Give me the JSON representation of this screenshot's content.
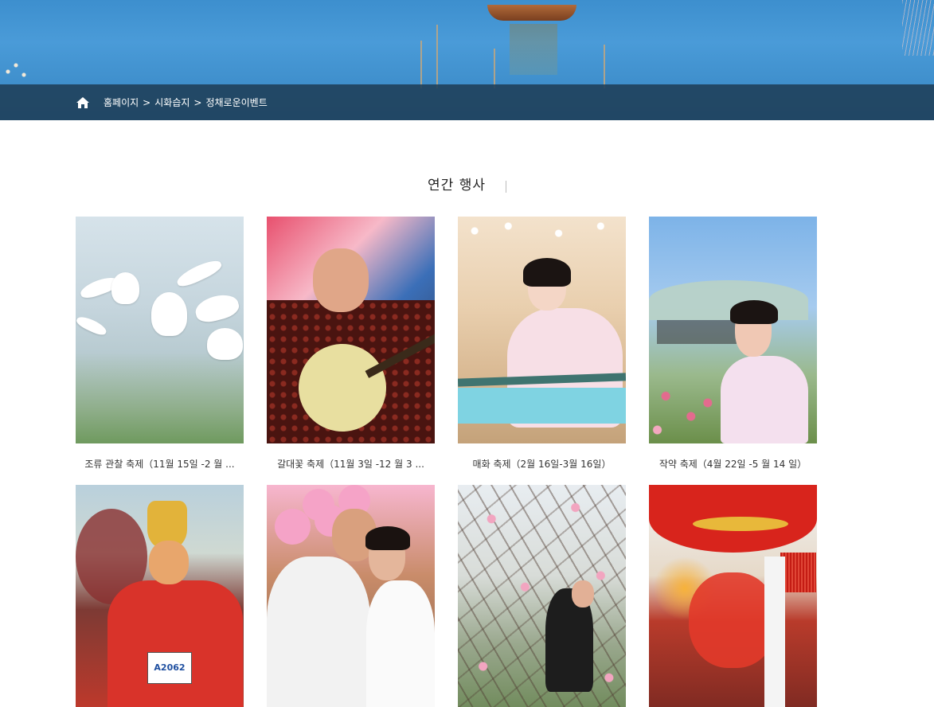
{
  "breadcrumb": {
    "home_icon": "home-icon",
    "items": [
      "홈페이지",
      "시화습지",
      "정채로운이벤트"
    ],
    "separator": ">"
  },
  "section": {
    "title": "연간 행사"
  },
  "events": [
    {
      "caption": "조류 관찰 축제（11월 15일 -2 월 ..."
    },
    {
      "caption": "갈대꽃 축제（11월 3일 -12 월 3 ..."
    },
    {
      "caption": "매화 축제（2월 16일-3월 16일）"
    },
    {
      "caption": "작약 축제（4월 22일 -5 월 14 일）"
    },
    {
      "caption": ""
    },
    {
      "caption": ""
    },
    {
      "caption": ""
    },
    {
      "caption": ""
    }
  ],
  "photo_texts": {
    "monkey_bib": "A2062"
  },
  "colors": {
    "breadcrumb_bar": "#1f3f58",
    "hero_sky": "#3d8fce"
  }
}
